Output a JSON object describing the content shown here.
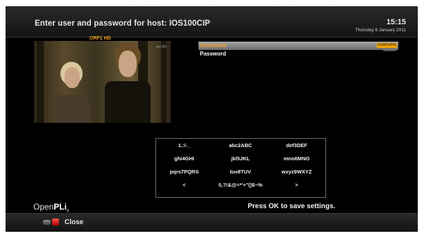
{
  "header": {
    "title": "Enter user and password for host: IOS100CIP",
    "clock": "15:15",
    "date": "Thursday 6 January 2011"
  },
  "preview": {
    "channel": "ORF1 HD",
    "overlay_logo": "orf·HD"
  },
  "form": {
    "fields": [
      {
        "label": "Username",
        "value": "username",
        "selected": true
      },
      {
        "label": "Password",
        "value": "********",
        "selected": false
      }
    ]
  },
  "keypad": {
    "rows": [
      [
        "1.:/-_",
        "abc2ABC",
        "def3DEF"
      ],
      [
        "ghi4GHI",
        "jkl5JKL",
        "mno6MNO"
      ],
      [
        "pqrs7PQRS",
        "tuv8TUV",
        "wxyz9WXYZ"
      ],
      [
        "<",
        "0,?!&@=*'+\"()$~%",
        ">"
      ]
    ]
  },
  "branding": {
    "name_prefix": "Open",
    "name_suffix": "PLi",
    "mark": "®"
  },
  "hint": "Press OK to save settings.",
  "footer": {
    "exit_icon_text": "EXIT",
    "close_label": "Close"
  },
  "colors": {
    "accent": "#f4a400",
    "background": "#000000",
    "close_button": "#e02020"
  }
}
